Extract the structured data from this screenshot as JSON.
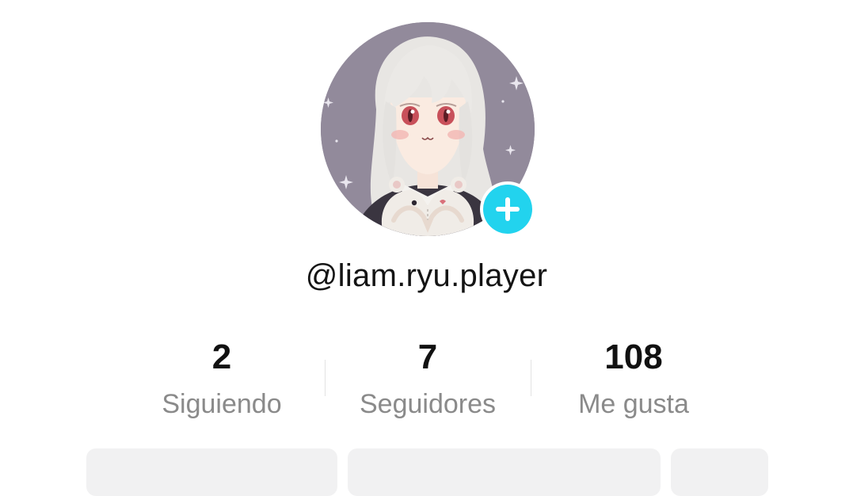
{
  "profile": {
    "username": "@liam.ryu.player",
    "avatar_icon": "anime-girl-avatar",
    "add_icon": "plus-icon",
    "accent_color": "#22d3ee"
  },
  "stats": [
    {
      "value": "2",
      "label": "Siguiendo"
    },
    {
      "value": "7",
      "label": "Seguidores"
    },
    {
      "value": "108",
      "label": "Me gusta"
    }
  ]
}
